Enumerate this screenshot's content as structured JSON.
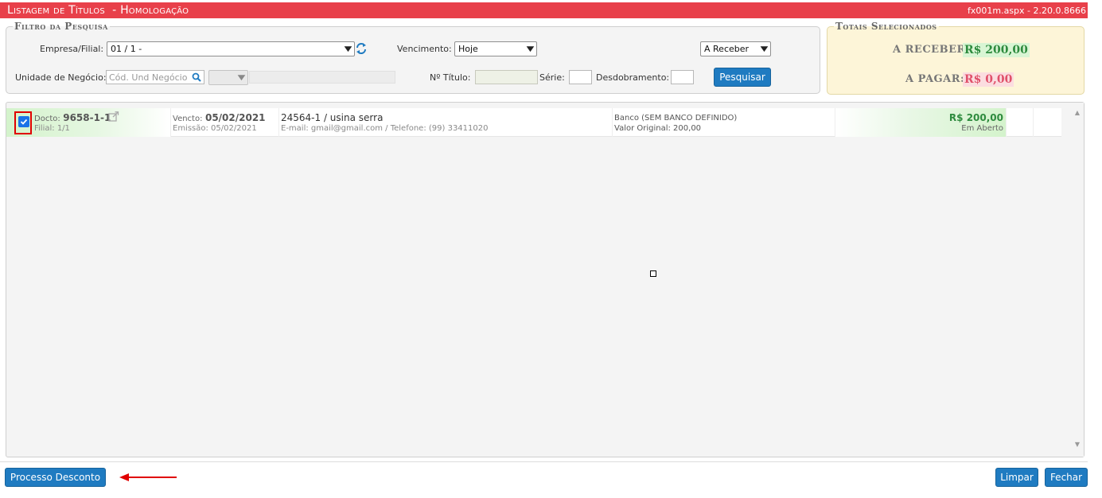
{
  "header": {
    "title": "Listagem de Títulos  - Homologação",
    "version": "fx001m.aspx - 2.20.0.8666"
  },
  "filter": {
    "legend": "Filtro da Pesquisa",
    "empresa_label": "Empresa/Filial:",
    "empresa_value": "01 / 1 -",
    "vencimento_label": "Vencimento:",
    "vencimento_value": "Hoje",
    "tipo_value": "A Receber",
    "unidade_label": "Unidade de Negócio:",
    "unidade_placeholder": "Cód. Und Negócio",
    "titulo_label": "Nº Título:",
    "serie_label": "Série:",
    "desdobramento_label": "Desdobramento:",
    "search_button": "Pesquisar"
  },
  "totals": {
    "legend": "Totais Selecionados",
    "receber_label": "A RECEBER:",
    "receber_value": "R$ 200,00",
    "pagar_label": "A PAGAR:",
    "pagar_value": "R$ 0,00"
  },
  "rows": [
    {
      "checked": true,
      "docto_label": "Docto:",
      "docto_value": "9658-1-1",
      "filial": "Filial: 1/1",
      "vencto_label": "Vencto:",
      "vencto_value": "05/02/2021",
      "emissao": "Emissão: 05/02/2021",
      "cliente": "24564-1 / usina serra",
      "contato": "E-mail: gmail@gmail.com / Telefone: (99) 33411020",
      "banco": "Banco (SEM BANCO DEFINIDO)",
      "valor_original": "Valor Original: 200,00",
      "valor": "R$ 200,00",
      "status": "Em Aberto"
    }
  ],
  "footer": {
    "processo_button": "Processo Desconto",
    "limpar_button": "Limpar",
    "fechar_button": "Fechar"
  },
  "colors": {
    "header": "#e8404a",
    "button": "#1f7bc1",
    "receber": "#2e8b3e",
    "pagar": "#e0506a",
    "totals_bg": "#fdf5d8"
  }
}
